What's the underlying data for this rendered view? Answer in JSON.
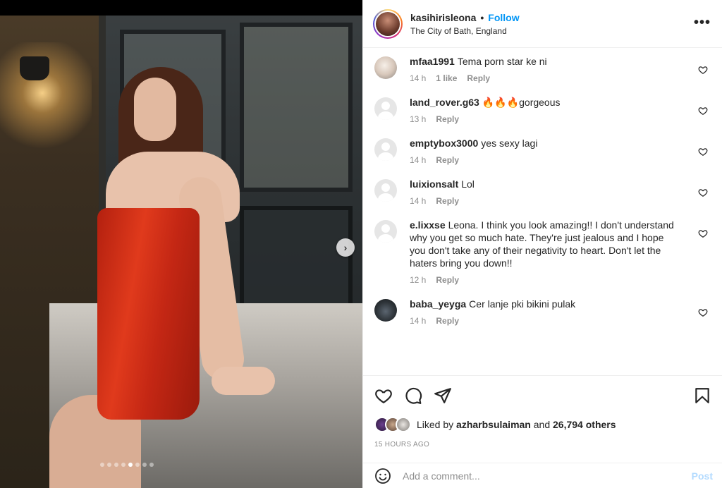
{
  "post": {
    "username": "kasihirisleona",
    "dot": "•",
    "follow_label": "Follow",
    "location": "The City of Bath, England",
    "more_label": "•••",
    "carousel": {
      "total": 8,
      "active_index": 4
    }
  },
  "comments": [
    {
      "user": "mfaa1991",
      "text": "Tema porn star ke ni",
      "time": "14 h",
      "likes": "1 like",
      "reply": "Reply",
      "avatar": "photo1"
    },
    {
      "user": "land_rover.g63",
      "text": "🔥🔥🔥gorgeous",
      "time": "13 h",
      "likes": "",
      "reply": "Reply",
      "avatar": "default"
    },
    {
      "user": "emptybox3000",
      "text": "yes sexy lagi",
      "time": "14 h",
      "likes": "",
      "reply": "Reply",
      "avatar": "default"
    },
    {
      "user": "luixionsalt",
      "text": "Lol",
      "time": "14 h",
      "likes": "",
      "reply": "Reply",
      "avatar": "default"
    },
    {
      "user": "e.lixxse",
      "text": "Leona. I think you look amazing!! I don't understand why you get so much hate. They're just jealous and I hope you don't take any of their negativity to heart. Don't let the haters bring you down!!",
      "time": "12 h",
      "likes": "",
      "reply": "Reply",
      "avatar": "default"
    },
    {
      "user": "baba_yeyga",
      "text": "Cer lanje pki bikini pulak",
      "time": "14 h",
      "likes": "",
      "reply": "Reply",
      "avatar": "photo2"
    }
  ],
  "likes": {
    "prefix": "Liked by",
    "user": "azharbsulaiman",
    "and": "and",
    "others": "26,794 others"
  },
  "timestamp": "15 HOURS AGO",
  "add_comment": {
    "placeholder": "Add a comment...",
    "post_label": "Post"
  },
  "colors": {
    "link_blue": "#0095f6",
    "post_disabled": "#b3dbff",
    "muted": "#8e8e8e"
  },
  "icons": [
    "heart-icon",
    "comment-icon",
    "share-icon",
    "save-icon",
    "emoji-icon",
    "next-arrow-icon",
    "more-icon"
  ]
}
